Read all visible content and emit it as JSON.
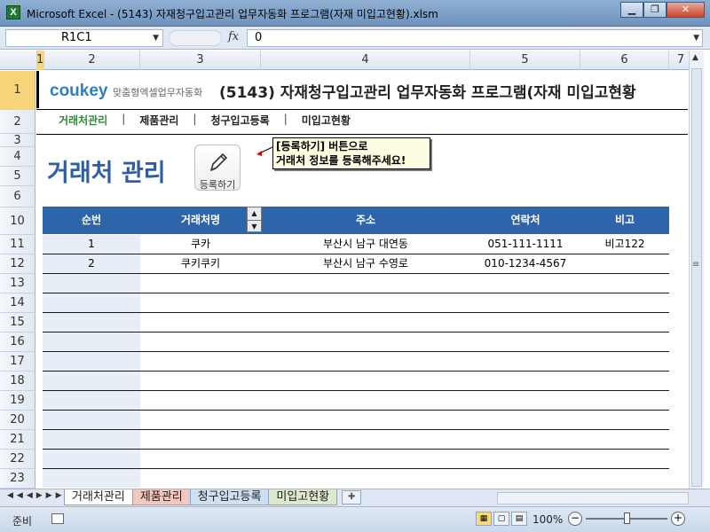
{
  "window": {
    "title": "Microsoft Excel - (5143) 자재청구입고관리 업무자동화 프로그램(자재 미입고현황).xlsm",
    "app_icon": "X"
  },
  "formula_bar": {
    "name_box": "R1C1",
    "fx": "fx",
    "content": "0"
  },
  "columns": [
    "1",
    "2",
    "3",
    "4",
    "5",
    "6",
    "7"
  ],
  "rows": [
    "1",
    "2",
    "3",
    "4",
    "5",
    "6",
    "10",
    "11",
    "12",
    "13",
    "14",
    "15",
    "16",
    "17",
    "18",
    "19",
    "20",
    "21",
    "22",
    "23"
  ],
  "sheet": {
    "logo_brand": "coukey",
    "logo_tag": "맞춤형엑셀업무자동화",
    "app_title": "(5143) 자재청구입고관리 업무자동화 프로그램(자재 미입고현황",
    "nav": [
      "거래처관리",
      "제품관리",
      "청구입고등록",
      "미입고현황"
    ],
    "nav_sep": "|",
    "page_title": "거래처 관리",
    "register_button": "등록하기",
    "tip_line1": "[등록하기] 버튼으로",
    "tip_line2": "거래처 정보를 등록해주세요!"
  },
  "table": {
    "headers": [
      "순번",
      "거래처명",
      "주소",
      "연락처",
      "비고"
    ],
    "rows": [
      [
        "1",
        "쿠카",
        "부산시 남구 대연동",
        "051-111-1111",
        "비고122"
      ],
      [
        "2",
        "쿠키쿠키",
        "부산시 남구 수영로",
        "010-1234-4567",
        ""
      ]
    ]
  },
  "sheet_tabs": [
    "거래처관리",
    "제품관리",
    "청구입고등록",
    "미입고현황"
  ],
  "status": {
    "ready": "준비",
    "zoom": "100%"
  },
  "colors": {
    "accent": "#2e64a9",
    "title_blue": "#2f5ea6",
    "nav_active": "#2f8a3a"
  }
}
